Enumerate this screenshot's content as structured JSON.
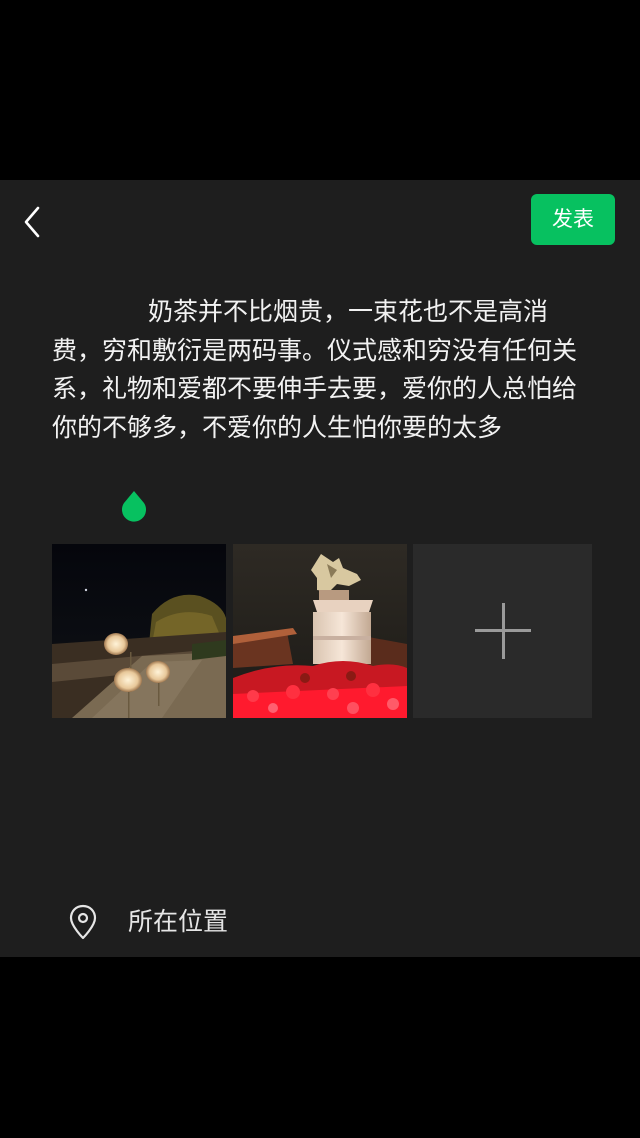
{
  "header": {
    "back_icon": "chevron-left-icon",
    "post_label": "发表"
  },
  "post": {
    "text": "奶茶并不比烟贵，一束花也不是高消费，穷和敷衍是两码事。仪式感和穷没有任何关系，礼物和爱都不要伸手去要，爱你的人总怕给你的不够多，不爱你的人生怕你要的太多"
  },
  "photos": [
    {
      "description": "night-park-lamps"
    },
    {
      "description": "illuminated-monument-red-flowers"
    }
  ],
  "add_photo_icon": "plus-icon",
  "location": {
    "icon": "location-pin-icon",
    "label": "所在位置"
  },
  "colors": {
    "accent": "#07c160",
    "background": "#1e1e1e",
    "outer": "#000000"
  }
}
